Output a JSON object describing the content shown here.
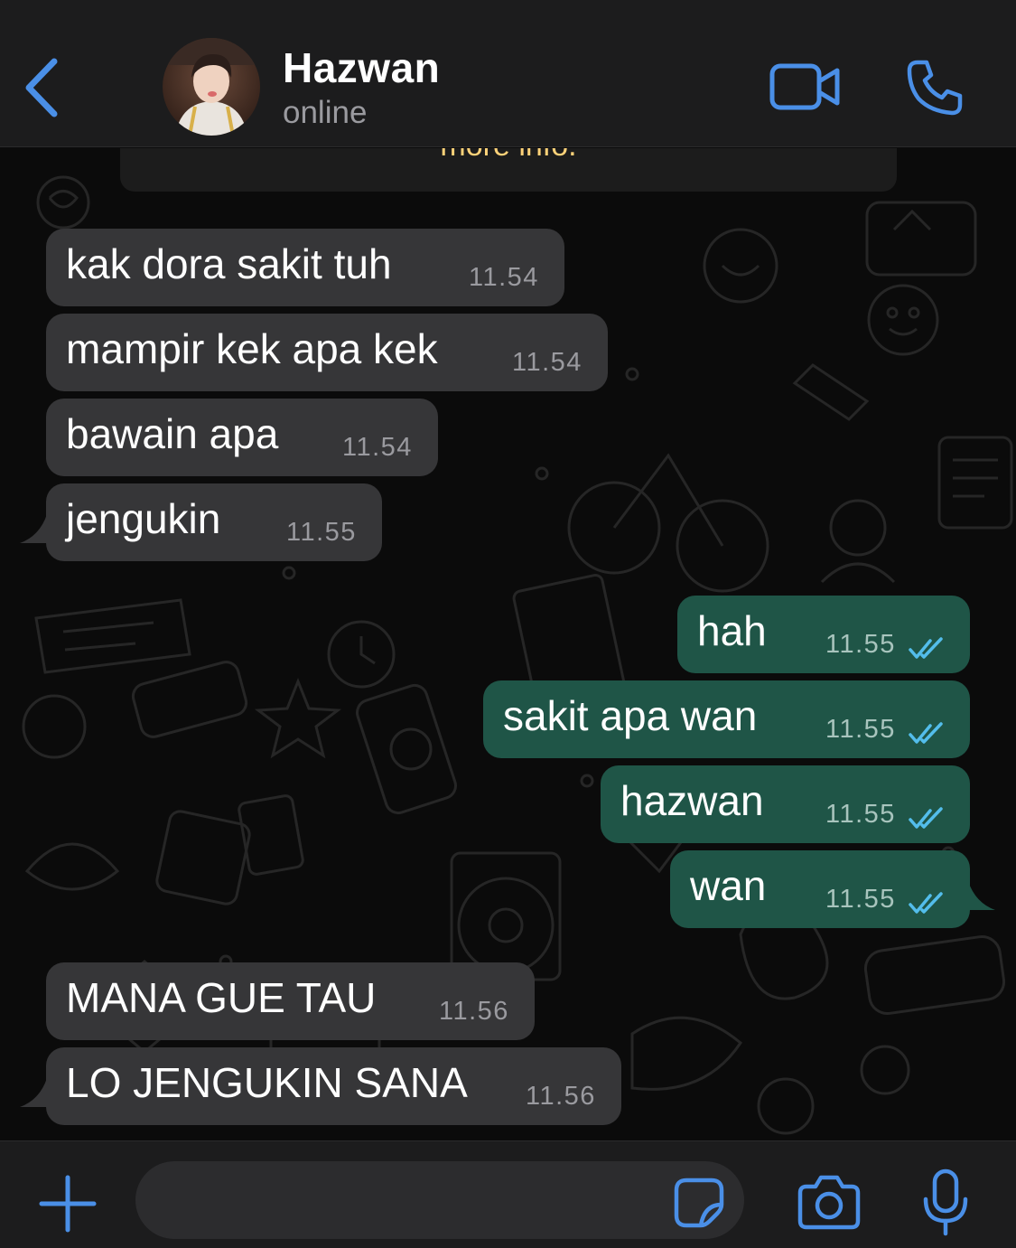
{
  "header": {
    "contact_name": "Hazwan",
    "status": "online",
    "icons": [
      "chevron-left-icon",
      "video-camera-icon",
      "phone-icon"
    ]
  },
  "system_note": "more info.",
  "messages": [
    {
      "direction": "in",
      "text": "kak dora sakit tuh",
      "time": "11.54"
    },
    {
      "direction": "in",
      "text": "mampir kek apa kek",
      "time": "11.54"
    },
    {
      "direction": "in",
      "text": "bawain apa",
      "time": "11.54"
    },
    {
      "direction": "in",
      "text": "jengukin",
      "time": "11.55"
    },
    {
      "direction": "out",
      "text": "hah",
      "time": "11.55",
      "status": "read"
    },
    {
      "direction": "out",
      "text": "sakit apa wan",
      "time": "11.55",
      "status": "read"
    },
    {
      "direction": "out",
      "text": "hazwan",
      "time": "11.55",
      "status": "read"
    },
    {
      "direction": "out",
      "text": "wan",
      "time": "11.55",
      "status": "read"
    },
    {
      "direction": "in",
      "text": "MANA GUE TAU",
      "time": "11.56"
    },
    {
      "direction": "in",
      "text": "LO JENGUKIN SANA",
      "time": "11.56"
    }
  ],
  "composer": {
    "placeholder": "",
    "icons": [
      "plus-icon",
      "sticker-icon",
      "camera-icon",
      "microphone-icon"
    ]
  },
  "colors": {
    "accent": "#4a8fe7",
    "incoming_bubble": "#363638",
    "outgoing_bubble": "#1f5547",
    "read_tick": "#53bdeb",
    "system_note_text": "#ffd279"
  }
}
